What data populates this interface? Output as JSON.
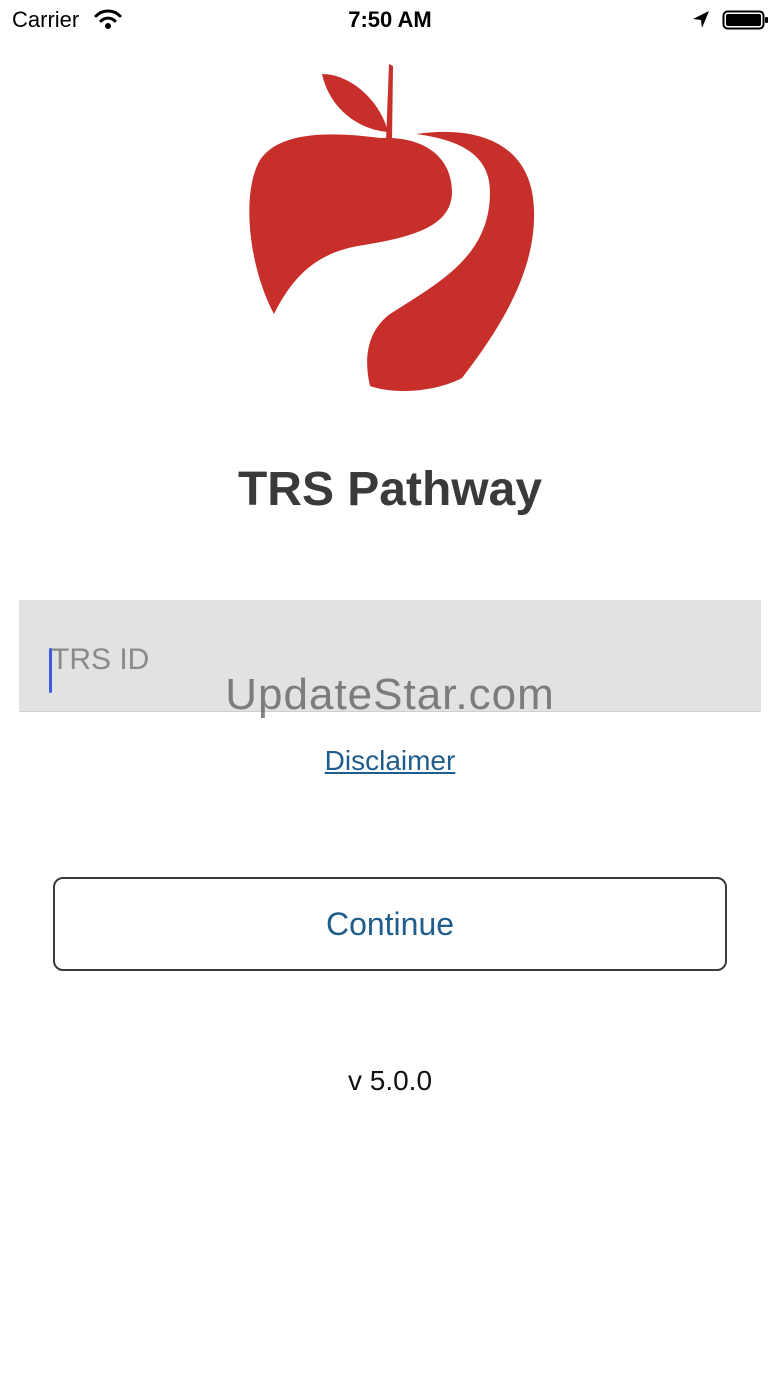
{
  "status_bar": {
    "carrier": "Carrier",
    "time": "7:50 AM",
    "icons": [
      "wifi-icon",
      "location-arrow-icon",
      "battery-icon"
    ]
  },
  "logo": {
    "icon": "red-apple-logo",
    "color": "#c72f2b"
  },
  "app_title": "TRS Pathway",
  "id_field": {
    "value": "",
    "placeholder": "TRS ID"
  },
  "watermark": "UpdateStar.com",
  "disclaimer_link": "Disclaimer",
  "continue_button": "Continue",
  "version": "v 5.0.0",
  "colors": {
    "accent": "#1f5d8c",
    "brand_red": "#c72f2b",
    "field_background": "#e2e2e2"
  }
}
